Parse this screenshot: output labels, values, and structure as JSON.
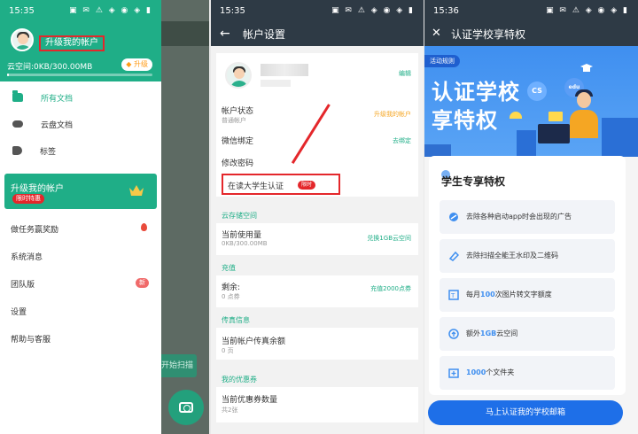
{
  "panel1": {
    "status": {
      "time": "15:35",
      "icons": "▣ ✉ ⚠ ◈ ◉ ◈ ▮"
    },
    "header": {
      "upgrade_account": "升级我的帐户",
      "space_label": "云空间:0KB/300.00MB",
      "upgrade_pill": "升级",
      "space_used_fraction": 0.0
    },
    "nav": [
      {
        "label": "所有文档",
        "active": true,
        "icon": "folder-icon"
      },
      {
        "label": "云盘文档",
        "active": false,
        "icon": "cloud-icon"
      },
      {
        "label": "标签",
        "active": false,
        "icon": "tag-icon"
      }
    ],
    "upgrade_card": {
      "title": "升级我的帐户",
      "badge": "限时特惠",
      "icon": "crown-icon"
    },
    "menu": [
      {
        "label": "做任务赢奖励",
        "extra": "flame-icon"
      },
      {
        "label": "系统消息"
      },
      {
        "label": "团队版",
        "badge": "新"
      },
      {
        "label": "设置"
      },
      {
        "label": "帮助与客服"
      }
    ],
    "background": {
      "scan_text": "开始扫描",
      "camera_icon": "camera-icon"
    }
  },
  "panel2": {
    "status": {
      "time": "15:35",
      "icons": "▣ ✉ ⚠ ◈ ◉ ◈ ▮"
    },
    "title": "帐户设置",
    "edit": "编辑",
    "rows": {
      "status_label": "帐户状态",
      "status_sub": "普通帐户",
      "status_right": "升级我的帐户",
      "wechat_label": "微信绑定",
      "wechat_right": "去绑定",
      "password_label": "修改密码",
      "edu_label": "在读大学生认证",
      "edu_badge": "限时"
    },
    "storage": {
      "section": "云存储空间",
      "label": "当前使用量",
      "sub": "0KB/300.00MB",
      "right": "兑换1GB云空间"
    },
    "recharge": {
      "section": "充值",
      "label": "剩余:",
      "sub": "0 点券",
      "right": "充值2000点券"
    },
    "fax": {
      "section": "传真信息",
      "label": "当前帐户传真余额",
      "sub": "0 页"
    },
    "coupon": {
      "section": "我的优惠券",
      "label": "当前优惠券数量",
      "sub": "共2张"
    }
  },
  "panel3": {
    "status": {
      "time": "15:36",
      "icons": "▣ ✉ ⚠ ◈ ◉ ◈ ▮"
    },
    "title": "认证学校享特权",
    "banner": {
      "rule": "活动规则",
      "line1": "认证学校",
      "line2": "享特权",
      "bubble_cs": "CS",
      "bubble_edu": "edu"
    },
    "card_title": "学生专享特权",
    "items": [
      {
        "pre": "去除各种启动app时会出现的广告",
        "strong": "",
        "post": "",
        "icon": "no-ads-icon"
      },
      {
        "pre": "去除扫描全能王水印及二维码",
        "strong": "",
        "post": "",
        "icon": "eraser-icon"
      },
      {
        "pre": "每月",
        "strong": "100",
        "post": "次图片转文字额度",
        "icon": "ocr-icon"
      },
      {
        "pre": "额外",
        "strong": "1GB",
        "post": "云空间",
        "icon": "cloud-upload-icon"
      },
      {
        "pre": "",
        "strong": "1000",
        "post": "个文件夹",
        "icon": "folder-plus-icon"
      }
    ],
    "cta": "马上认证我的学校邮箱"
  }
}
